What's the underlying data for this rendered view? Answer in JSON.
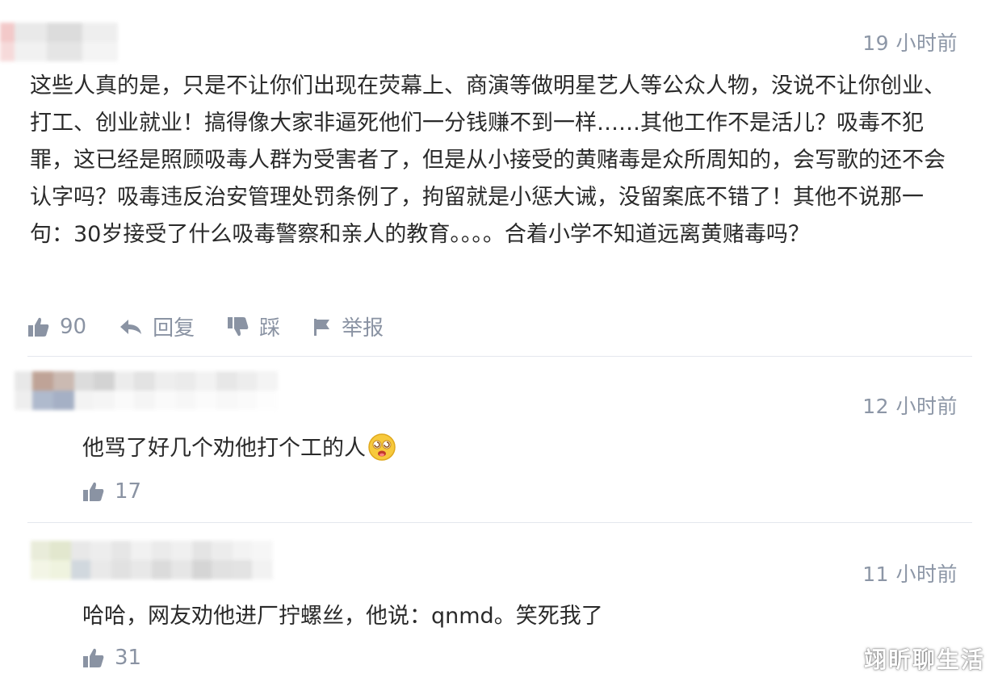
{
  "comments": [
    {
      "time": "19 小时前",
      "text": "这些人真的是，只是不让你们出现在荧幕上、商演等做明星艺人等公众人物，没说不让你创业、打工、创业就业！搞得像大家非逼死他们一分钱赚不到一样……其他工作不是活儿？吸毒不犯罪，这已经是照顾吸毒人群为受害者了，但是从小接受的黄赌毒是众所周知的，会写歌的还不会认字吗？吸毒违反治安管理处罚条例了，拘留就是小惩大诫，没留案底不错了！其他不说那一句：30岁接受了什么吸毒警察和亲人的教育。。。。合着小学不知道远离黄赌毒吗？",
      "likes": "90",
      "reply_label": "回复",
      "dislike_label": "踩",
      "report_label": "举报"
    },
    {
      "time": "12 小时前",
      "text": "他骂了好几个劝他打个工的人",
      "emoji_icon": "dizzy-face-emoji-icon",
      "likes": "17"
    },
    {
      "time": "11 小时前",
      "text": "哈哈，网友劝他进厂拧螺丝，他说：qnmd。笑死我了",
      "likes": "31"
    }
  ],
  "watermark": "翊昕聊生活",
  "colors": {
    "text": "#2a2a2a",
    "meta": "#8c96a6",
    "action": "#8a93a3",
    "divider": "#e4e7ee"
  },
  "icons": [
    "thumbs-up-icon",
    "reply-arrow-icon",
    "thumbs-down-icon",
    "flag-icon"
  ]
}
